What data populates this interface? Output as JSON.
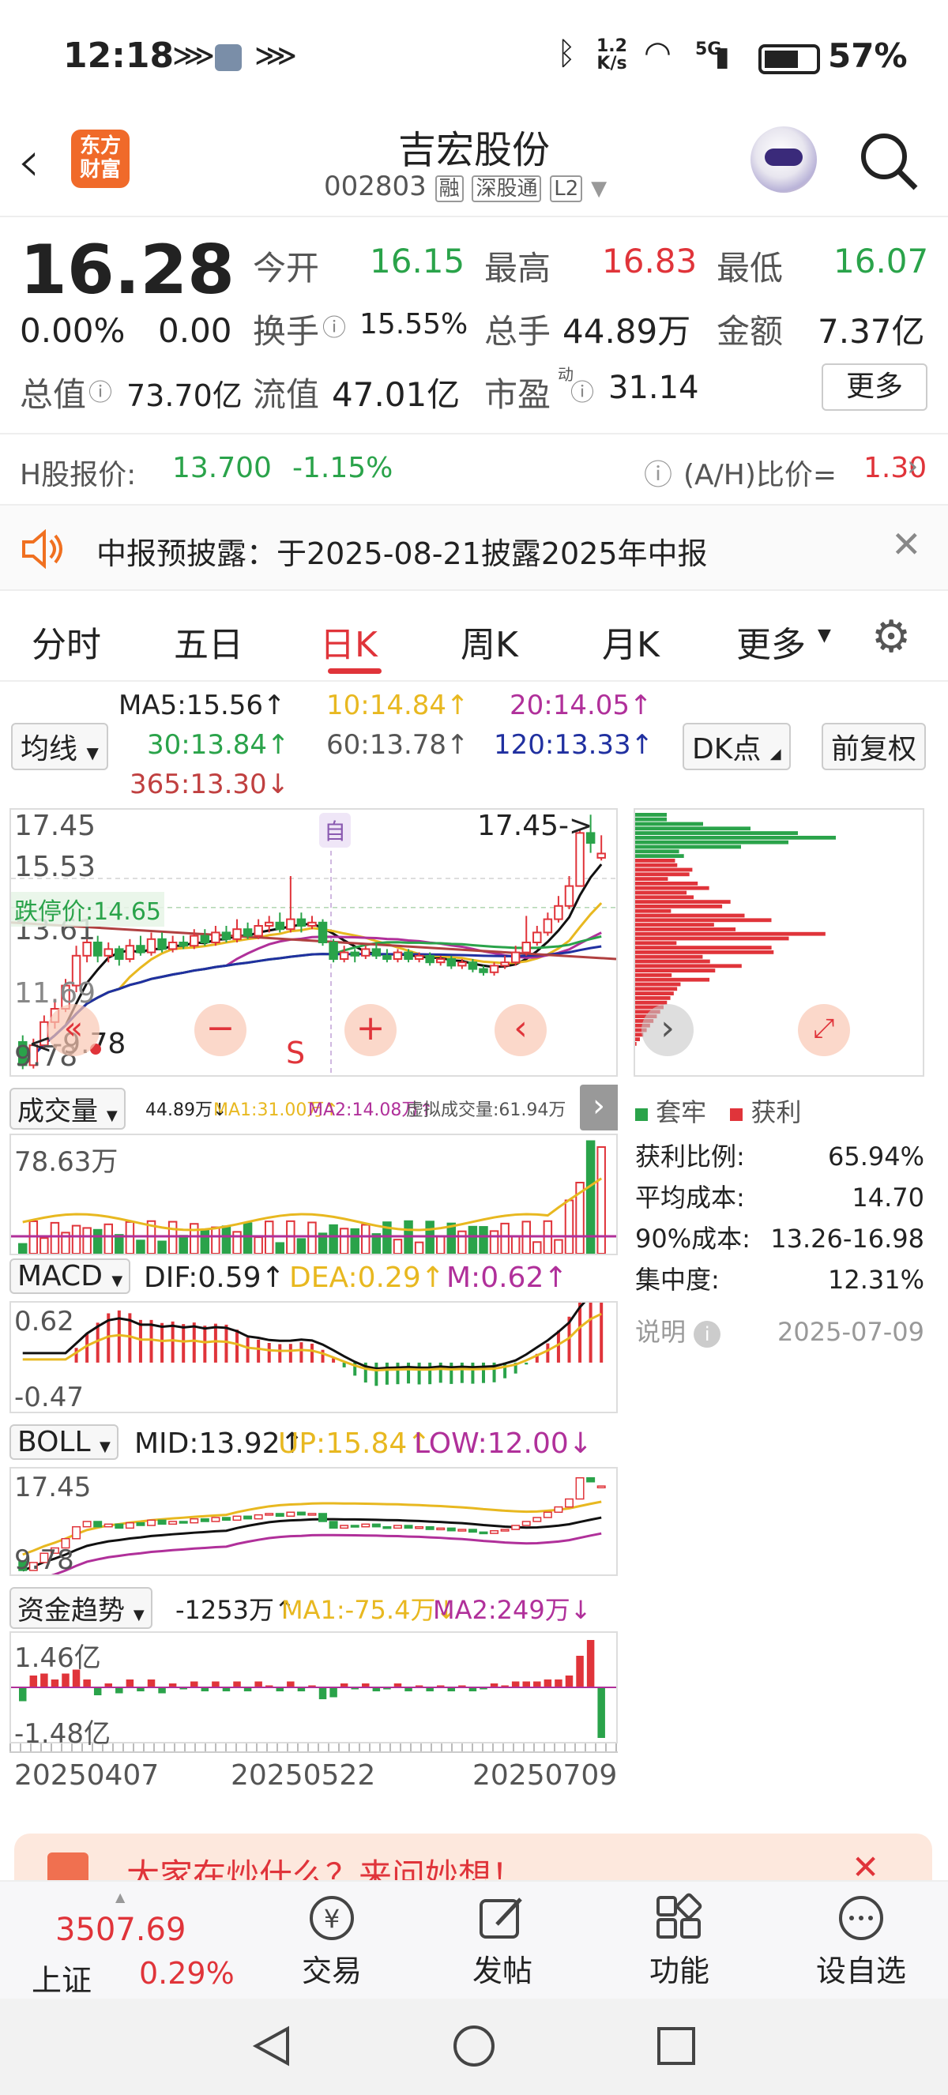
{
  "status": {
    "time": "12:18",
    "net_speed_top": "1.2",
    "net_speed_bottom": "K/s",
    "signal": "5G",
    "battery": "57%"
  },
  "header": {
    "title": "吉宏股份",
    "code": "002803",
    "tag_rong": "融",
    "tag_sgt": "深股通",
    "tag_l2": "L2",
    "logo_line1": "东方",
    "logo_line2": "财富"
  },
  "quote": {
    "price": "16.28",
    "change": "0.00%",
    "change_abs": "0.00",
    "open_label": "今开",
    "open": "16.15",
    "high_label": "最高",
    "high": "16.83",
    "low_label": "最低",
    "low": "16.07",
    "turnover_label": "换手",
    "turnover": "15.55%",
    "volume_label": "总手",
    "volume": "44.89万",
    "amount_label": "金额",
    "amount": "7.37亿",
    "mcap_label": "总值",
    "mcap": "73.70亿",
    "float_label": "流值",
    "float": "47.01亿",
    "pe_label": "市盈",
    "pe_sup": "动",
    "pe": "31.14",
    "more_button": "更多"
  },
  "hshare": {
    "label": "H股报价:",
    "price": "13.700",
    "change": "-1.15%",
    "ratio_label": "(A/H)比价=",
    "ratio": "1.30"
  },
  "notice": {
    "text": "中报预披露：于2025-08-21披露2025年中报"
  },
  "tabs": [
    {
      "label": "分时"
    },
    {
      "label": "五日"
    },
    {
      "label": "日K"
    },
    {
      "label": "周K"
    },
    {
      "label": "月K"
    },
    {
      "label": "更多"
    }
  ],
  "ma": {
    "selector": "均线",
    "ma5": "MA5:15.56↑",
    "ma10": "10:14.84↑",
    "ma20": "20:14.05↑",
    "ma30": "30:13.84↑",
    "ma60": "60:13.78↑",
    "ma120": "120:13.33↑",
    "ma365": "365:13.30↓",
    "dk_button": "DK点",
    "fq_button": "前复权"
  },
  "colors": {
    "red": "#e0343a",
    "green": "#2aa34a",
    "yellow": "#e8b820",
    "purple": "#b0309a",
    "blue": "#2030a0",
    "orange": "#f07020"
  },
  "kline": {
    "y_labels": [
      "17.45",
      "15.53",
      "13.61",
      "11.69",
      "9.78"
    ],
    "high_marker": "17.45->",
    "low_marker": "<-9.78",
    "limit_down": "跌停价:14.65",
    "self_label": "自",
    "s_label": "S",
    "candles": [
      {
        "o": 10.6,
        "c": 9.9,
        "h": 10.8,
        "l": 9.78
      },
      {
        "o": 9.9,
        "c": 10.5,
        "h": 10.7,
        "l": 9.8
      },
      {
        "o": 10.5,
        "c": 11.2,
        "h": 11.4,
        "l": 10.4
      },
      {
        "o": 11.2,
        "c": 11.6,
        "h": 11.9,
        "l": 11.0
      },
      {
        "o": 11.6,
        "c": 12.3,
        "h": 12.5,
        "l": 11.5
      },
      {
        "o": 12.3,
        "c": 13.2,
        "h": 13.5,
        "l": 12.1
      },
      {
        "o": 13.2,
        "c": 13.6,
        "h": 14.2,
        "l": 13.0
      },
      {
        "o": 13.6,
        "c": 13.2,
        "h": 13.8,
        "l": 13.0
      },
      {
        "o": 13.2,
        "c": 13.4,
        "h": 13.6,
        "l": 13.0
      },
      {
        "o": 13.4,
        "c": 13.1,
        "h": 13.5,
        "l": 12.9
      },
      {
        "o": 13.1,
        "c": 13.5,
        "h": 13.7,
        "l": 13.0
      },
      {
        "o": 13.5,
        "c": 13.3,
        "h": 13.8,
        "l": 13.2
      },
      {
        "o": 13.3,
        "c": 13.7,
        "h": 13.9,
        "l": 13.2
      },
      {
        "o": 13.7,
        "c": 13.4,
        "h": 13.9,
        "l": 13.3
      },
      {
        "o": 13.4,
        "c": 13.6,
        "h": 13.8,
        "l": 13.3
      },
      {
        "o": 13.6,
        "c": 13.5,
        "h": 13.8,
        "l": 13.4
      },
      {
        "o": 13.5,
        "c": 13.8,
        "h": 14.0,
        "l": 13.4
      },
      {
        "o": 13.8,
        "c": 13.6,
        "h": 14.0,
        "l": 13.5
      },
      {
        "o": 13.6,
        "c": 13.9,
        "h": 14.1,
        "l": 13.5
      },
      {
        "o": 13.9,
        "c": 13.7,
        "h": 14.1,
        "l": 13.6
      },
      {
        "o": 13.7,
        "c": 14.0,
        "h": 14.3,
        "l": 13.6
      },
      {
        "o": 14.0,
        "c": 13.8,
        "h": 14.2,
        "l": 13.7
      },
      {
        "o": 13.8,
        "c": 14.1,
        "h": 14.3,
        "l": 13.7
      },
      {
        "o": 14.1,
        "c": 14.2,
        "h": 14.4,
        "l": 13.9
      },
      {
        "o": 14.2,
        "c": 14.0,
        "h": 14.5,
        "l": 13.9
      },
      {
        "o": 14.0,
        "c": 14.3,
        "h": 15.6,
        "l": 13.9
      },
      {
        "o": 14.3,
        "c": 14.1,
        "h": 14.5,
        "l": 13.9
      },
      {
        "o": 14.1,
        "c": 14.2,
        "h": 14.4,
        "l": 14.0
      },
      {
        "o": 14.2,
        "c": 13.6,
        "h": 14.3,
        "l": 13.5
      },
      {
        "o": 13.6,
        "c": 13.1,
        "h": 13.7,
        "l": 13.0
      },
      {
        "o": 13.1,
        "c": 13.3,
        "h": 13.5,
        "l": 13.0
      },
      {
        "o": 13.3,
        "c": 13.2,
        "h": 13.4,
        "l": 13.0
      },
      {
        "o": 13.2,
        "c": 13.4,
        "h": 13.5,
        "l": 13.1
      },
      {
        "o": 13.4,
        "c": 13.2,
        "h": 13.6,
        "l": 13.1
      },
      {
        "o": 13.2,
        "c": 13.1,
        "h": 13.4,
        "l": 13.0
      },
      {
        "o": 13.1,
        "c": 13.3,
        "h": 13.4,
        "l": 13.0
      },
      {
        "o": 13.3,
        "c": 13.1,
        "h": 13.4,
        "l": 13.0
      },
      {
        "o": 13.1,
        "c": 13.2,
        "h": 13.3,
        "l": 13.0
      },
      {
        "o": 13.2,
        "c": 13.0,
        "h": 13.3,
        "l": 12.9
      },
      {
        "o": 13.0,
        "c": 13.1,
        "h": 13.2,
        "l": 12.9
      },
      {
        "o": 13.1,
        "c": 12.9,
        "h": 13.2,
        "l": 12.8
      },
      {
        "o": 12.9,
        "c": 13.0,
        "h": 13.1,
        "l": 12.8
      },
      {
        "o": 13.0,
        "c": 12.8,
        "h": 13.1,
        "l": 12.7
      },
      {
        "o": 12.8,
        "c": 12.7,
        "h": 12.9,
        "l": 12.6
      },
      {
        "o": 12.7,
        "c": 12.9,
        "h": 13.0,
        "l": 12.6
      },
      {
        "o": 12.9,
        "c": 13.0,
        "h": 13.2,
        "l": 12.8
      },
      {
        "o": 13.0,
        "c": 13.3,
        "h": 13.5,
        "l": 12.9
      },
      {
        "o": 13.3,
        "c": 13.6,
        "h": 14.4,
        "l": 13.2
      },
      {
        "o": 13.6,
        "c": 13.9,
        "h": 14.1,
        "l": 13.5
      },
      {
        "o": 13.9,
        "c": 14.3,
        "h": 14.5,
        "l": 13.8
      },
      {
        "o": 14.3,
        "c": 14.7,
        "h": 15.0,
        "l": 14.2
      },
      {
        "o": 14.7,
        "c": 15.3,
        "h": 15.6,
        "l": 14.6
      },
      {
        "o": 15.3,
        "c": 16.9,
        "h": 17.0,
        "l": 15.3
      },
      {
        "o": 16.9,
        "c": 16.6,
        "h": 17.45,
        "l": 16.3
      },
      {
        "o": 16.15,
        "c": 16.28,
        "h": 16.83,
        "l": 16.07
      }
    ]
  },
  "chip_panel": {
    "legend_trapped": "套牢",
    "legend_profit": "获利",
    "rows": [
      {
        "label": "获利比例:",
        "value": "65.94%"
      },
      {
        "label": "平均成本:",
        "value": "14.70"
      },
      {
        "label": "90%成本:",
        "value": "13.26-16.98"
      },
      {
        "label": "集中度:",
        "value": "12.31%"
      }
    ],
    "note_label": "说明",
    "date": "2025-07-09"
  },
  "volume": {
    "selector": "成交量",
    "legend": "44.89万↓",
    "ma1": "MA1:31.00万↑",
    "ma2": "MA2:14.08万↑",
    "virtual": "虚拟成交量:61.94万",
    "y_label": "78.63万"
  },
  "macd": {
    "selector": "MACD",
    "dif": "DIF:0.59↑",
    "dea": "DEA:0.29↑",
    "m": "M:0.62↑",
    "y_top": "0.62",
    "y_bottom": "-0.47"
  },
  "boll": {
    "selector": "BOLL",
    "mid": "MID:13.92↑",
    "up": "UP:15.84↑",
    "low": "LOW:12.00↓",
    "y_top": "17.45",
    "y_bottom": "9.78"
  },
  "fund": {
    "selector": "资金趋势",
    "val": "-1253万↑",
    "ma1": "MA1:-75.4万↓",
    "ma2": "MA2:249万↓",
    "y_top": "1.46亿",
    "y_bottom": "-1.48亿"
  },
  "dates": [
    "20250407",
    "20250522",
    "20250709"
  ],
  "banner": {
    "text": "大家在炒什么？来问妙想！"
  },
  "bottom_nav": {
    "index_value": "3507.69",
    "index_name": "上证",
    "index_change": "0.29%",
    "items": [
      {
        "label": "交易"
      },
      {
        "label": "发帖"
      },
      {
        "label": "功能"
      },
      {
        "label": "设自选"
      }
    ]
  }
}
